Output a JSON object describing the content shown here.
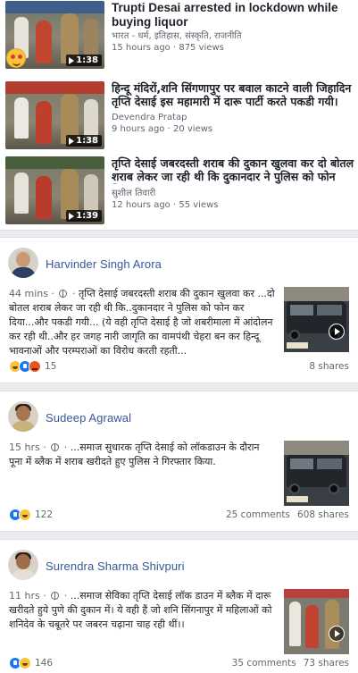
{
  "videos": [
    {
      "title": "Trupti Desai arrested in lockdown while buying liquor",
      "meta_line1": "भारत - धर्म, इतिहास, संस्कृति, राजनीति",
      "meta_line2": "15 hours ago · 875 views",
      "duration": "1:38",
      "has_emoji_badge": true,
      "title_lang": "en"
    },
    {
      "title": "हिन्दू मंदिरों,शनि सिंगणापुर पर बवाल काटने वाली जिहादिन तृप्ति देसाई इस महामारी में दारू पार्टी करते पकडी गयी।",
      "meta_line1": "Devendra Pratap",
      "meta_line2": "9 hours ago · 20 views",
      "duration": "1:38",
      "has_emoji_badge": false,
      "title_lang": "hi"
    },
    {
      "title": "तृप्ति देसाई जबरदस्ती शराब की दुकान खुलवा कर दो बोतल शराब लेकर जा रही थी कि दुकानदार ने पुलिस को फोन कि...",
      "meta_line1": "सुशील तिवारी",
      "meta_line2": "12 hours ago · 55 views",
      "duration": "1:39",
      "has_emoji_badge": false,
      "title_lang": "hi"
    }
  ],
  "posts": [
    {
      "author": "Harvinder Singh Arora",
      "time": "44 mins",
      "text": "तृप्ति देसाई जबरदस्ती शराब की दुकान खुलवा कर ...दो बोतल शराब लेकर जा रही थी कि..दुकानदार ने पुलिस को फोन कर दिया...और पकडी गयी... (ये वही तृप्ति देसाई है जो शबरीमाला में आंदोलन कर रही थी..और हर जगह नारी जागृति का वामपंथी चेहरा बन कर हिन्दू भावनाओं और परम्पराओं का विरोध करती रहती...",
      "reactions": [
        "haha",
        "like",
        "angry"
      ],
      "reaction_count": "15",
      "comments": "",
      "shares": "8 shares"
    },
    {
      "author": "Sudeep Agrawal",
      "time": "15 hrs",
      "text": "...समाज सुधारक तृप्ति देसाई को लॉकडाउन के दौरान पूना में ब्लैक में शराब खरीदते हुए पुलिस ने गिरफ्तार किया.",
      "reactions": [
        "like",
        "haha"
      ],
      "reaction_count": "122",
      "comments": "25 comments",
      "shares": "608 shares"
    },
    {
      "author": "Surendra Sharma Shivpuri",
      "time": "11 hrs",
      "text": "...समाज सेविका तृप्ति देसाई लॉक डाउन में ब्लैक में दारू खरीदते हुये पुणे की दुकान में। ये वही हैं जो शनि सिंगनापुर में महिलाओं को शनिदेव के चबूतरे पर जबरन चढ़ाना चाह रही थीं।।",
      "reactions": [
        "like",
        "haha"
      ],
      "reaction_count": "146",
      "comments": "35 comments",
      "shares": "73 shares"
    }
  ],
  "colors": {
    "link_blue": "#365899",
    "meta_gray": "#606770",
    "feed_bg": "#e9ebee",
    "like_blue": "#1877f2",
    "haha_yellow": "#f7c43a",
    "angry_orange": "#e8541e"
  }
}
